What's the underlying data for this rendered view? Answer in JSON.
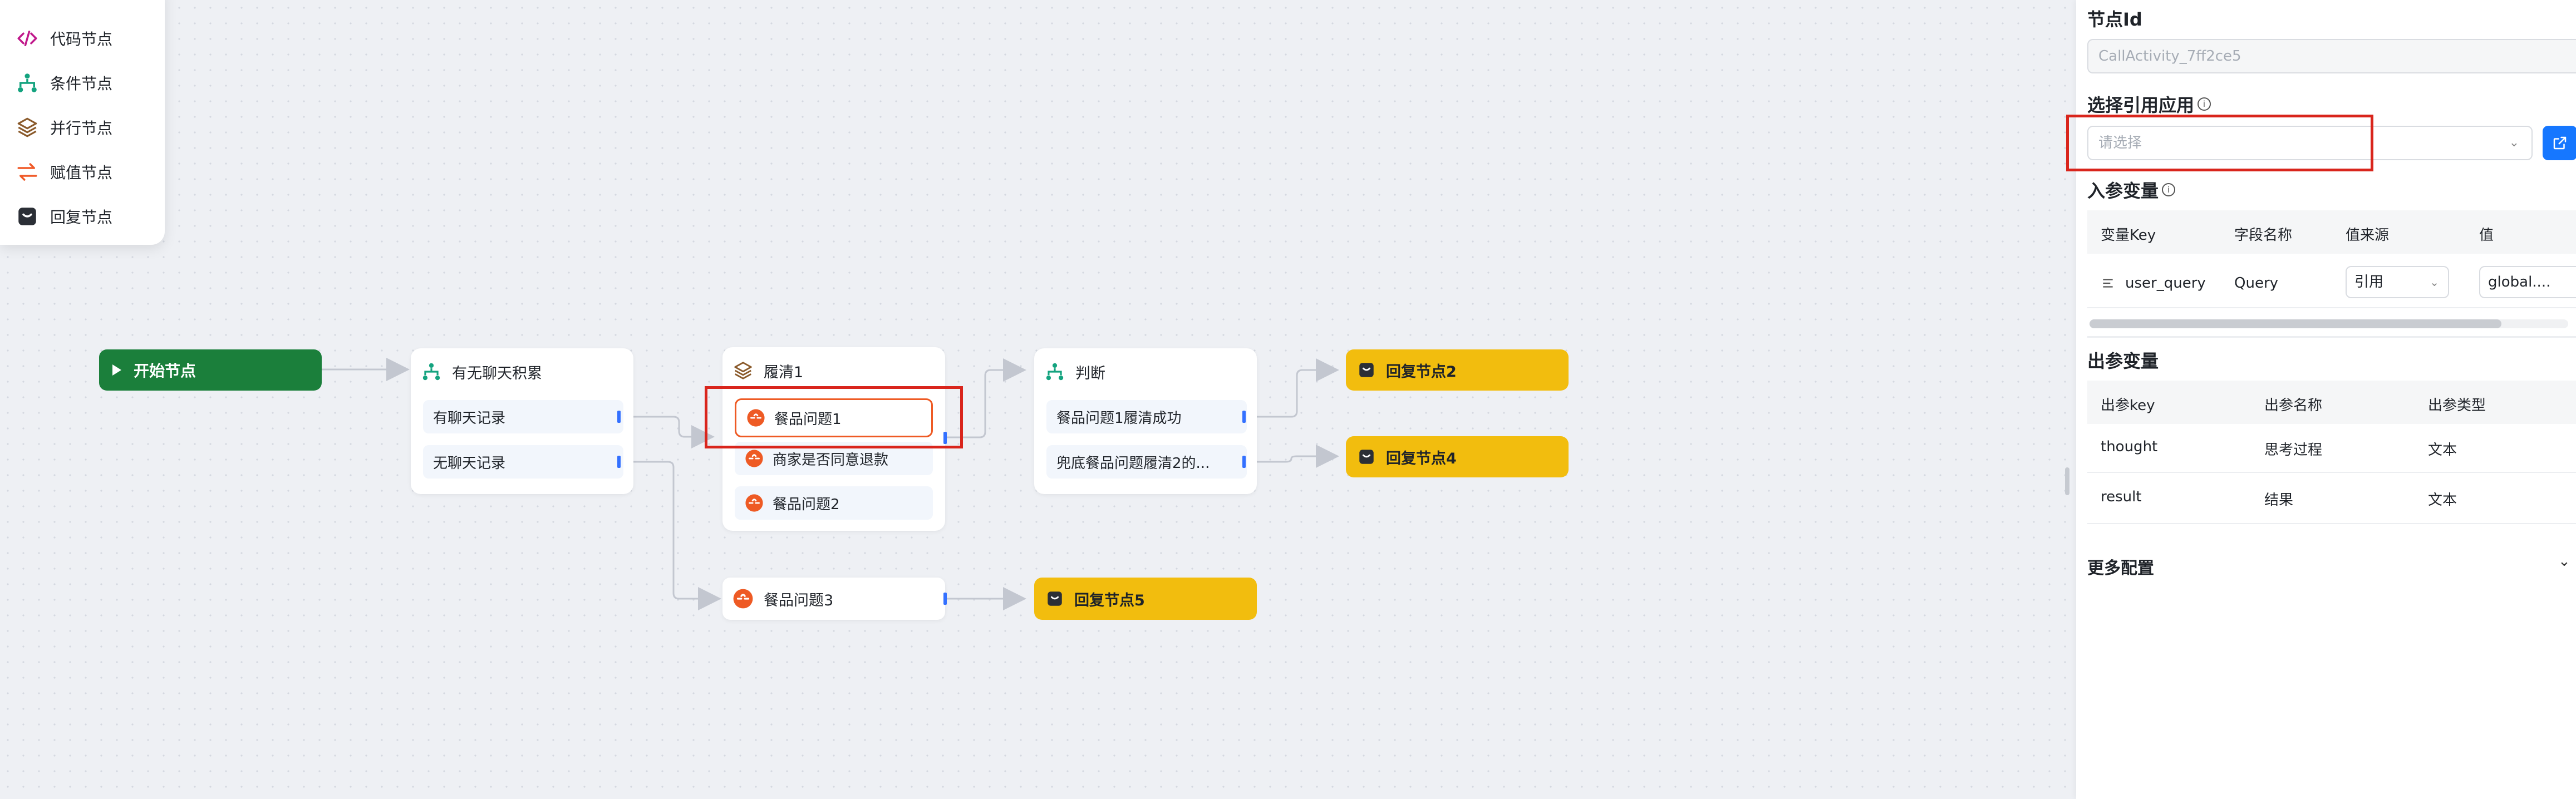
{
  "palette": {
    "items": [
      {
        "label": "代码节点",
        "icon": "code-icon"
      },
      {
        "label": "条件节点",
        "icon": "condition-icon"
      },
      {
        "label": "并行节点",
        "icon": "parallel-icon"
      },
      {
        "label": "赋值节点",
        "icon": "assign-icon"
      },
      {
        "label": "回复节点",
        "icon": "reply-icon"
      }
    ]
  },
  "canvas": {
    "start_node": {
      "label": "开始节点"
    },
    "history_node": {
      "title": "有无聊天积累",
      "branches": [
        "有聊天记录",
        "无聊天记录"
      ]
    },
    "clarify_node": {
      "title": "履清1",
      "items": [
        "餐品问题1",
        "商家是否同意退款",
        "餐品问题2"
      ]
    },
    "judge_node": {
      "title": "判断",
      "branches": [
        "餐品问题1履清成功",
        "兜底餐品问题履清2的..."
      ]
    },
    "meal3_node": {
      "label": "餐品问题3"
    },
    "reply_nodes": [
      "回复节点2",
      "回复节点4",
      "回复节点5"
    ]
  },
  "panel": {
    "node_id": {
      "title": "节点Id",
      "value": "CallActivity_7ff2ce5"
    },
    "ref_app": {
      "title": "选择引用应用",
      "info": "i",
      "placeholder": "请选择",
      "caret": "⌄"
    },
    "input_vars": {
      "title": "入参变量",
      "info": "i",
      "columns": [
        "变量Key",
        "字段名称",
        "值来源",
        "值"
      ],
      "rows": [
        {
          "key": "user_query",
          "name": "Query",
          "source": "引用",
          "value": "global...."
        }
      ]
    },
    "output_vars": {
      "title": "出参变量",
      "columns": [
        "出参key",
        "出参名称",
        "出参类型"
      ],
      "rows": [
        {
          "key": "thought",
          "name": "思考过程",
          "type": "文本"
        },
        {
          "key": "result",
          "name": "结果",
          "type": "文本"
        }
      ]
    },
    "more": {
      "title": "更多配置",
      "caret": "⌄"
    }
  },
  "colors": {
    "start": "#1b7f3b",
    "reply": "#f2bd0e",
    "highlight": "#d9251c",
    "accent": "#1677ff",
    "meal_icon": "#ee5a24"
  }
}
